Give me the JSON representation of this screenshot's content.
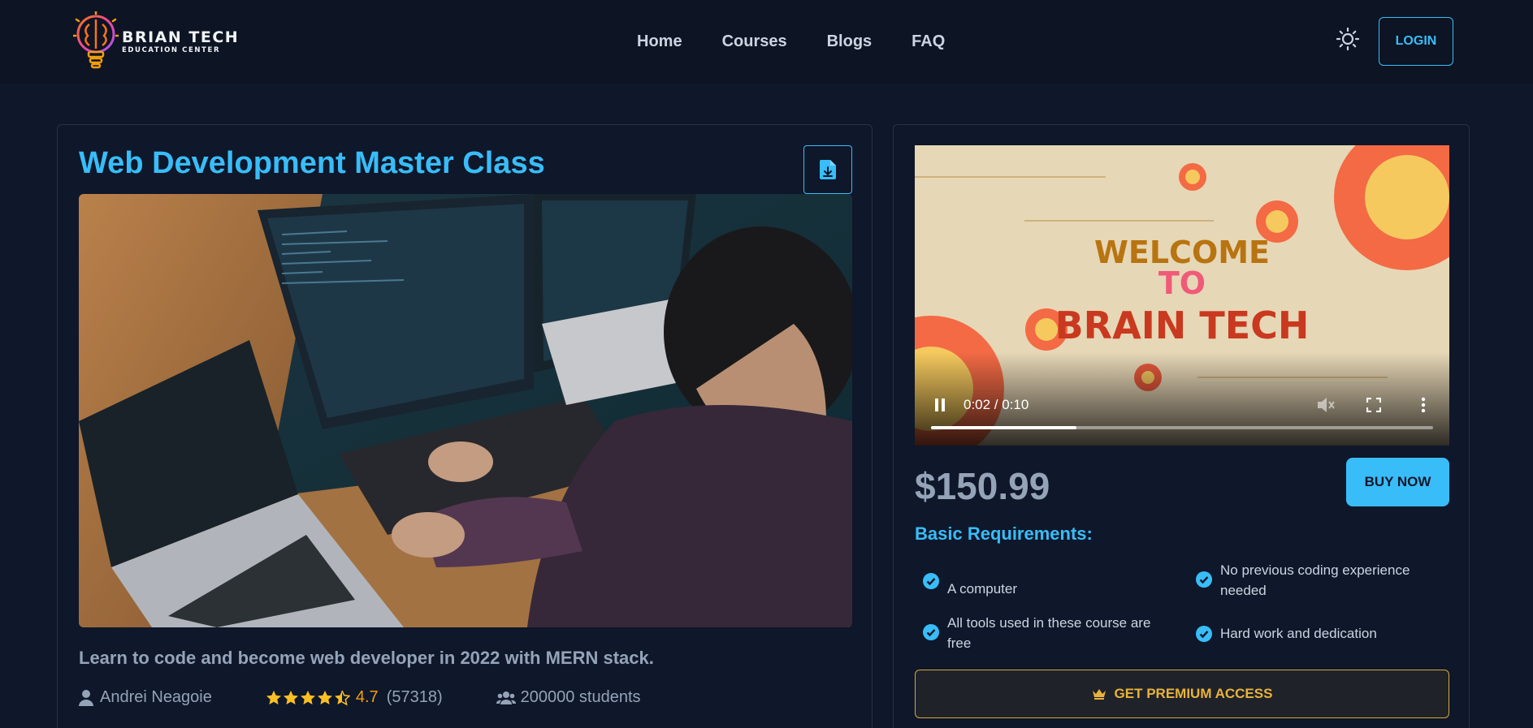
{
  "brand": {
    "title": "BRIAN TECH",
    "subtitle": "EDUCATION CENTER"
  },
  "nav": {
    "links": [
      "Home",
      "Courses",
      "Blogs",
      "FAQ"
    ],
    "login_label": "LOGIN"
  },
  "course": {
    "title": "Web Development Master Class",
    "description": "Learn to code and become web developer in 2022 with MERN stack.",
    "instructor": "Andrei Neagoie",
    "rating": "4.7",
    "rating_count": "(57318)",
    "rating_stars": 4.5,
    "students": "200000 students"
  },
  "video": {
    "line1": "WELCOME",
    "line2": "TO",
    "line3": "BRAIN TECH",
    "time": "0:02 / 0:10",
    "progress": 0.29
  },
  "purchase": {
    "price": "$150.99",
    "buy_label": "BUY NOW",
    "requirements_title": "Basic Requirements:",
    "requirements": [
      "A computer",
      "No previous coding experience needed",
      "All tools used in these course are free",
      "Hard work and dedication"
    ],
    "premium_label": "GET PREMIUM ACCESS"
  },
  "colors": {
    "accent": "#38bdf8",
    "gold": "#e8b33c",
    "background": "#0f172a"
  },
  "icons": [
    "brain-bulb-logo-icon",
    "sun-icon",
    "file-download-icon",
    "user-icon",
    "star-icon",
    "users-icon",
    "check-circle-icon",
    "crown-icon",
    "pause-icon",
    "volume-icon",
    "fullscreen-icon",
    "more-vertical-icon"
  ]
}
